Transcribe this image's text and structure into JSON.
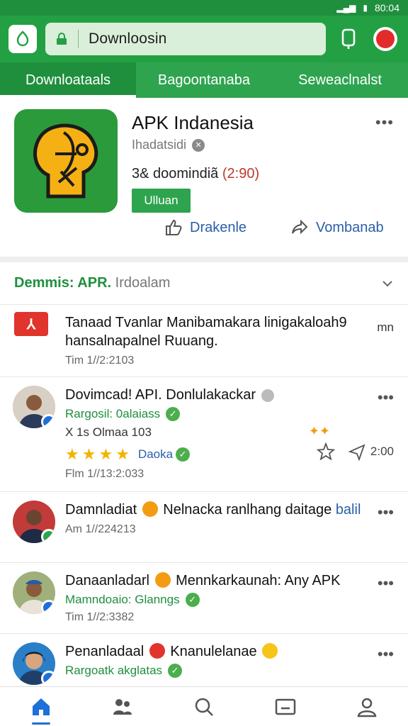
{
  "status": {
    "time": "80:04"
  },
  "header": {
    "url_text": "Downloosin"
  },
  "tabs": [
    {
      "label": "Downloataals"
    },
    {
      "label": "Bagoontanaba"
    },
    {
      "label": "Seweaclnalst"
    }
  ],
  "app": {
    "name": "APK Indanesia",
    "developer": "Ihadatsidi",
    "downloads_prefix": "3&  doomindiã",
    "downloads_count": "(2:90)",
    "install_label": "Ulluan",
    "like_label": "Drakenle",
    "share_label": "Vombanab"
  },
  "section": {
    "title_bold": "Demmis: APR.",
    "title_rest": "Irdoalam"
  },
  "feed": [
    {
      "text": "Tanaad Tvanlar Manibamakara linigakaloah9 hansalnapalnel Ruuang.",
      "tag": "mn",
      "time": "Tim 1//2:2103"
    },
    {
      "title": "Dovimcad! API. Donlulakackar",
      "green": "Rargosil: 0alaiass",
      "sub": "X 1s Olmaa 103",
      "rating_label": "Daoka",
      "action_value": "2:00",
      "time": "Flm 1//13:2:033"
    },
    {
      "title": "Damnladiat",
      "title_rest": "Nelnacka ranlhang daitage",
      "title_blue": "balil",
      "time": "Am 1//224213"
    },
    {
      "title": "Danaanladarl",
      "title_rest": "Mennkarkaunah: Any APK",
      "green": "Mamndoaio: Glanngs",
      "time": "Tim 1//2:3382"
    },
    {
      "title": "Penanladaal",
      "title_rest": "Knanulelanae",
      "green": "Rargoatk akglatas"
    }
  ],
  "colors": {
    "brand_green": "#23a043",
    "link_blue": "#2a5fa8",
    "accent_red": "#e0342c"
  },
  "icons": [
    "app-logo-icon",
    "lock-icon",
    "phone-icon",
    "profile-icon",
    "like-icon",
    "share-icon",
    "chevron-down-icon",
    "home-icon",
    "people-icon",
    "search-icon",
    "inbox-icon",
    "user-icon"
  ]
}
